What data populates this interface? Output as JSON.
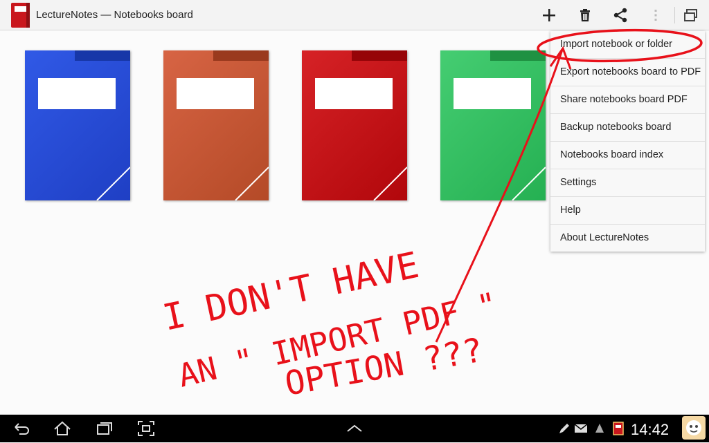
{
  "app": {
    "title": "LectureNotes — Notebooks board"
  },
  "actionbar": {
    "buttons": [
      "plus-icon",
      "trash-icon",
      "share-icon",
      "overflow-menu-icon",
      "window-icon"
    ]
  },
  "notebooks": [
    {
      "color": "#2a4fdc"
    },
    {
      "color": "#c95a37"
    },
    {
      "color": "#c8141a"
    },
    {
      "color": "#34c065"
    }
  ],
  "menu": {
    "items": [
      "Import notebook or folder",
      "Export notebooks board to PDF",
      "Share notebooks board PDF",
      "Backup notebooks board",
      "Notebooks board index",
      "Settings",
      "Help",
      "About LectureNotes"
    ]
  },
  "annotation": {
    "lines": [
      "I DON'T HAVE",
      "AN \" IMPORT PDF \"",
      "OPTION ???"
    ],
    "color": "#e8111a"
  },
  "statusbar": {
    "time": "14:42"
  },
  "colors": {
    "accent_red": "#c9171d",
    "menu_bg": "#f8f8f8",
    "navbar_bg": "#000000"
  }
}
